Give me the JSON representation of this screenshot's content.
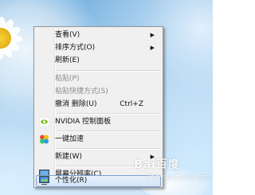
{
  "context_menu": {
    "items": [
      {
        "label": "查看(V)",
        "has_submenu": true
      },
      {
        "label": "排序方式(O)",
        "has_submenu": true
      },
      {
        "label": "刷新(E)"
      },
      {
        "label": "粘贴(P)",
        "disabled": true
      },
      {
        "label": "粘贴快捷方式(S)",
        "disabled": true
      },
      {
        "label": "撤消 删除(U)",
        "shortcut": "Ctrl+Z"
      },
      {
        "label": "NVIDIA 控制面板",
        "icon": "nvidia-icon"
      },
      {
        "label": "一键加速",
        "icon": "accelerate-icon"
      },
      {
        "label": "新建(W)",
        "has_submenu": true
      },
      {
        "label": "屏幕分辨率(C)",
        "icon": "display-icon"
      },
      {
        "label": "个性化(R)",
        "icon": "personalize-icon",
        "highlighted": true
      }
    ]
  },
  "watermark": {
    "brand": "Bai百度",
    "sub": "jingyan.baidu.com"
  },
  "colors": {
    "menu_bg": "#f0f0f0",
    "highlight_bg": "#d4e5f8",
    "highlight_border": "#7da2ce",
    "disabled_text": "#8d8d8d",
    "nvidia_green": "#76b900"
  }
}
